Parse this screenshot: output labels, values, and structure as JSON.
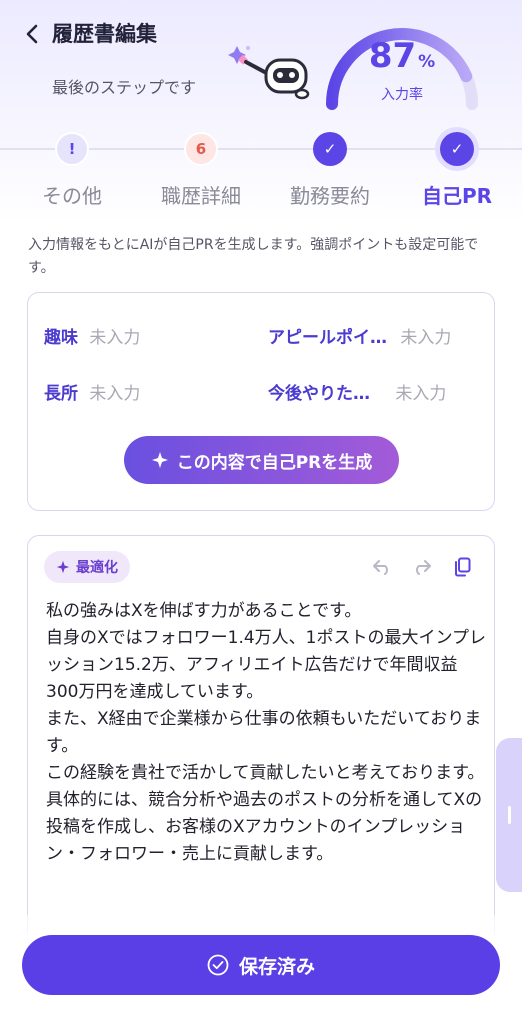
{
  "header": {
    "title": "履歴書編集",
    "subtitle": "最後のステップです",
    "progress_value": "87",
    "progress_unit": "%",
    "progress_label": "入力率",
    "progress_fraction": 0.87
  },
  "steps": [
    {
      "label": "その他",
      "badge": "!",
      "state": "warning"
    },
    {
      "label": "職歴詳細",
      "badge": "6",
      "state": "count"
    },
    {
      "label": "勤務要約",
      "badge": "✓",
      "state": "done"
    },
    {
      "label": "自己PR",
      "badge": "✓",
      "state": "active"
    }
  ],
  "description": "入力情報をもとにAIが自己PRを生成します。強調ポイントも設定可能です。",
  "fields": {
    "hobby": {
      "label": "趣味",
      "value": "未入力"
    },
    "appeal": {
      "label": "アピールポイ…",
      "value": "未入力"
    },
    "strength": {
      "label": "長所",
      "value": "未入力"
    },
    "future": {
      "label": "今後やりた…",
      "value": "未入力"
    }
  },
  "generate_button": "この内容で自己PRを生成",
  "result": {
    "badge": "最適化",
    "text": "私の強みはXを伸ばす力があることです。\n自身のXではフォロワー1.4万人、1ポストの最大インプレッション15.2万、アフィリエイト広告だけで年間収益300万円を達成しています。\nまた、X経由で企業様から仕事の依頼もいただいております。\nこの経験を貴社で活かして貢献したいと考えております。具体的には、競合分析や過去のポストの分析を通してXの投稿を作成し、お客様のXアカウントのインプレッション・フォロワー・売上に貢献します。"
  },
  "save_button": "保存済み",
  "colors": {
    "accent": "#5b45e6",
    "warning_badge": "#e35a4a"
  }
}
